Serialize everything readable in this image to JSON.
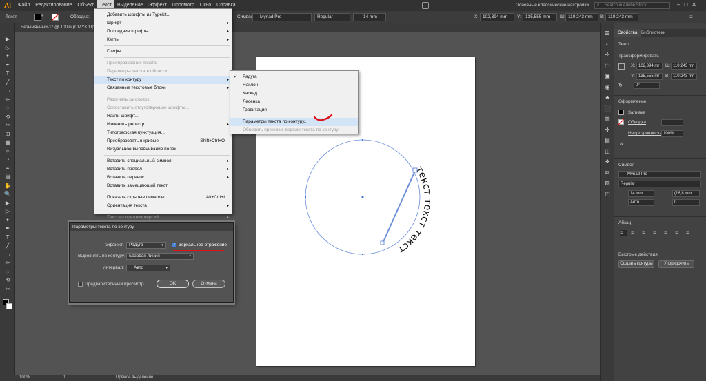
{
  "app": {
    "logo": "Ai"
  },
  "menubar": {
    "items": [
      "Файл",
      "Редактирование",
      "Объект",
      "Текст",
      "Выделение",
      "Эффект",
      "Просмотр",
      "Окно",
      "Справка"
    ],
    "workspace": "Основные классические настройки",
    "search_placeholder": "Search in Adobe Stock"
  },
  "controlbar": {
    "mode": "Текст",
    "stroke_label": "Обводка:",
    "char_label": "Символ:",
    "font": "Myriad Pro",
    "style": "Regular",
    "size": "14 mm",
    "x_label": "X:",
    "x": "102,394 mm",
    "y_label": "Y:",
    "y": "135,555 mm",
    "w_label": "Ш:",
    "w": "110,243 mm",
    "h_label": "В:",
    "h": "110,243 mm"
  },
  "document": {
    "tab": "Безымянный-1* @ 100% (CMYK/Пред"
  },
  "status": {
    "zoom": "100%",
    "page": "1",
    "mode": "Прямое выделение"
  },
  "text_menu": {
    "items": [
      {
        "label": "Добавить шрифты из Typekit...",
        "enabled": true
      },
      {
        "label": "Шрифт",
        "enabled": true,
        "sub": true
      },
      {
        "label": "Последние шрифты",
        "enabled": true,
        "sub": true
      },
      {
        "label": "Кегль",
        "enabled": true,
        "sub": true
      },
      {
        "sep": true
      },
      {
        "label": "Глифы",
        "enabled": true
      },
      {
        "sep": true
      },
      {
        "label": "Преобразование текста",
        "enabled": false
      },
      {
        "label": "Параметры текста в области...",
        "enabled": false
      },
      {
        "label": "Текст по контуру",
        "enabled": true,
        "sub": true,
        "highlight": true
      },
      {
        "label": "Связанные текстовые блоки",
        "enabled": true,
        "sub": true
      },
      {
        "sep": true
      },
      {
        "label": "Разогнать заголовок",
        "enabled": false
      },
      {
        "label": "Сопоставить отсутствующие шрифты...",
        "enabled": false
      },
      {
        "label": "Найти шрифт...",
        "enabled": true
      },
      {
        "label": "Изменить регистр",
        "enabled": true,
        "sub": true
      },
      {
        "label": "Типографская пунктуация...",
        "enabled": true
      },
      {
        "label": "Преобразовать в кривые",
        "enabled": true,
        "shortcut": "Shift+Ctrl+O"
      },
      {
        "label": "Визуальное выравнивание полей",
        "enabled": true
      },
      {
        "sep": true
      },
      {
        "label": "Вставить специальный символ",
        "enabled": true,
        "sub": true
      },
      {
        "label": "Вставить пробел",
        "enabled": true,
        "sub": true
      },
      {
        "label": "Вставить перенос",
        "enabled": true,
        "sub": true
      },
      {
        "label": "Вставить замещающий текст",
        "enabled": true
      },
      {
        "sep": true
      },
      {
        "label": "Показать скрытые символы",
        "enabled": true,
        "shortcut": "Alt+Ctrl+I"
      },
      {
        "label": "Ориентация текста",
        "enabled": true,
        "sub": true
      },
      {
        "sep": true
      },
      {
        "label": "Текст из прежних версий",
        "enabled": false,
        "sub": true
      }
    ]
  },
  "path_submenu": {
    "items": [
      {
        "label": "Радуга",
        "checked": true,
        "enabled": true
      },
      {
        "label": "Наклон",
        "enabled": true
      },
      {
        "label": "Каскад",
        "enabled": true
      },
      {
        "label": "Лесенка",
        "enabled": true
      },
      {
        "label": "Гравитация",
        "enabled": true
      },
      {
        "sep": true
      },
      {
        "label": "Параметры текста по контуру...",
        "enabled": true,
        "highlight": true
      },
      {
        "label": "Обновить прежнюю версию текста по контуру",
        "enabled": false
      }
    ]
  },
  "dialog": {
    "title": "Параметры текста по контуру",
    "effect_label": "Эффект:",
    "effect_value": "Радуга",
    "mirror_label": "Зеркальное отражение",
    "align_label": "Выровнять по контуру:",
    "align_value": "Базовая линия",
    "spacing_label": "Интервал:",
    "spacing_value": "Авто",
    "preview_label": "Предварительный просмотр",
    "ok": "OK",
    "cancel": "Отмена"
  },
  "canvas": {
    "path_text": "текст текст текст"
  },
  "rightpanel": {
    "tabs": [
      "Свойства",
      "Библиотеки"
    ],
    "section_text": "Текст",
    "transform_title": "Трансформировать",
    "x_label": "X:",
    "x": "102,394 mr",
    "y_label": "Y:",
    "y": "135,555 mr",
    "w_label": "Ш:",
    "w": "110,243 mr",
    "h_label": "В:",
    "h": "110,243 mr",
    "angle": "0°",
    "appearance_title": "Оформление",
    "fill_label": "Заливка",
    "stroke_label": "Обводка",
    "opacity_label": "Непрозрачность",
    "opacity_value": "100%",
    "fx_label": "fx.",
    "char_title": "Символ",
    "font": "Myriad Pro",
    "style": "Regular",
    "size": "14 mm",
    "leading": "(16,8 mm",
    "tracking": "Авто",
    "kerning": "0",
    "para_title": "Абзац",
    "quick_title": "Быстрые действия",
    "btn_outlines": "Создать контуры",
    "btn_arrange": "Упорядочить"
  },
  "colors": {
    "accent": "#3f7fd6",
    "highlight": "#d4e4f7",
    "annotation": "#e0101a",
    "path": "#6b8fd8"
  }
}
